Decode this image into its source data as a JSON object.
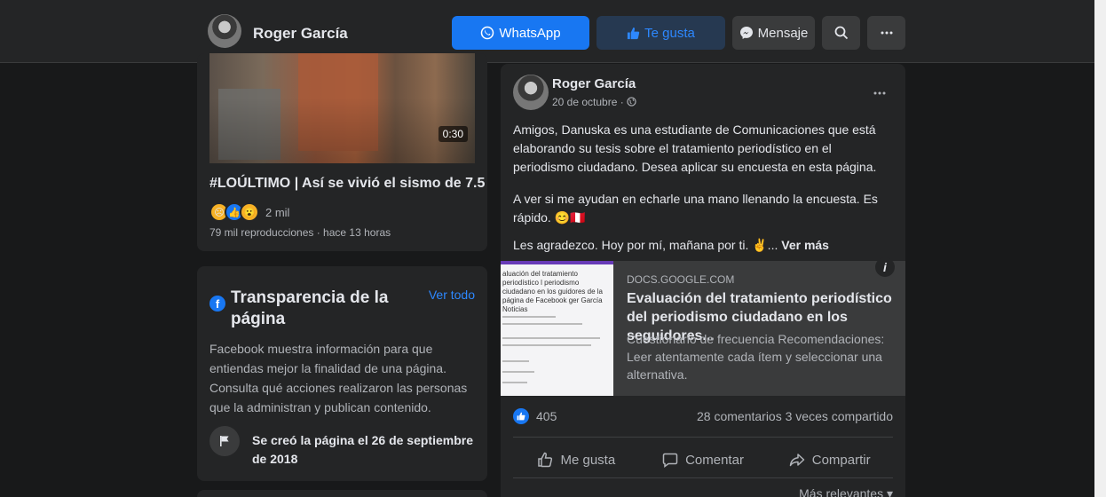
{
  "header": {
    "page_name": "Roger García",
    "whatsapp_label": "WhatsApp",
    "like_label": "Te gusta",
    "message_label": "Mensaje"
  },
  "icons": {
    "whatsapp": "whatsapp-icon",
    "like": "thumbs-up-icon",
    "messenger": "messenger-icon",
    "search": "search-icon",
    "more": "more-horizontal-icon",
    "flag": "flag-icon",
    "facebook": "facebook-icon",
    "globe": "globe-icon",
    "info": "info-icon",
    "comment": "comment-icon",
    "share": "share-icon"
  },
  "colors": {
    "accent": "#1877f2",
    "background": "#18191a",
    "card": "#242526",
    "link": "#2d88ff"
  },
  "video": {
    "duration": "0:30",
    "title": "#LOÚLTIMO | Así se vivió el sismo de 7.5 ...",
    "reactions": "2 mil",
    "meta": "79 mil reproducciones · hace 13 horas"
  },
  "transparency": {
    "title": "Transparencia de la página",
    "see_all": "Ver todo",
    "body": "Facebook muestra información para que entiendas mejor la finalidad de una página. Consulta qué acciones realizaron las personas que la administran y publican contenido.",
    "created": "Se creó la página el 26 de septiembre de 2018"
  },
  "post": {
    "author": "Roger García",
    "date": "20 de octubre · ",
    "paragraph1": "Amigos, Danuska es una estudiante de Comunicaciones que está elaborando su tesis sobre el tratamiento periodístico en el periodismo ciudadano. Desea aplicar su encuesta en esta página.",
    "paragraph2": "A ver si me ayudan en echarle una mano llenando la encuesta. Es rápido. 😊🇵🇪",
    "paragraph3": "Les agradezco.  Hoy por mí, mañana por ti. ✌️... ",
    "see_more": "Ver más",
    "link": {
      "domain": "DOCS.GOOGLE.COM",
      "title": "Evaluación del tratamiento periodístico del periodismo ciudadano en los seguidores...",
      "description": "Cuestionario de frecuencia Recomendaciones: Leer atentamente cada ítem y seleccionar una alternativa.",
      "thumb_text": "aluación del tratamiento periodístico l periodismo ciudadano en los guidores de la página de Facebook ger García Noticias"
    },
    "likes": "405",
    "comments_shares": "28 comentarios  3 veces compartido",
    "actions": {
      "like": "Me gusta",
      "comment": "Comentar",
      "share": "Compartir"
    },
    "sort_label": "Más relevantes ▾"
  }
}
